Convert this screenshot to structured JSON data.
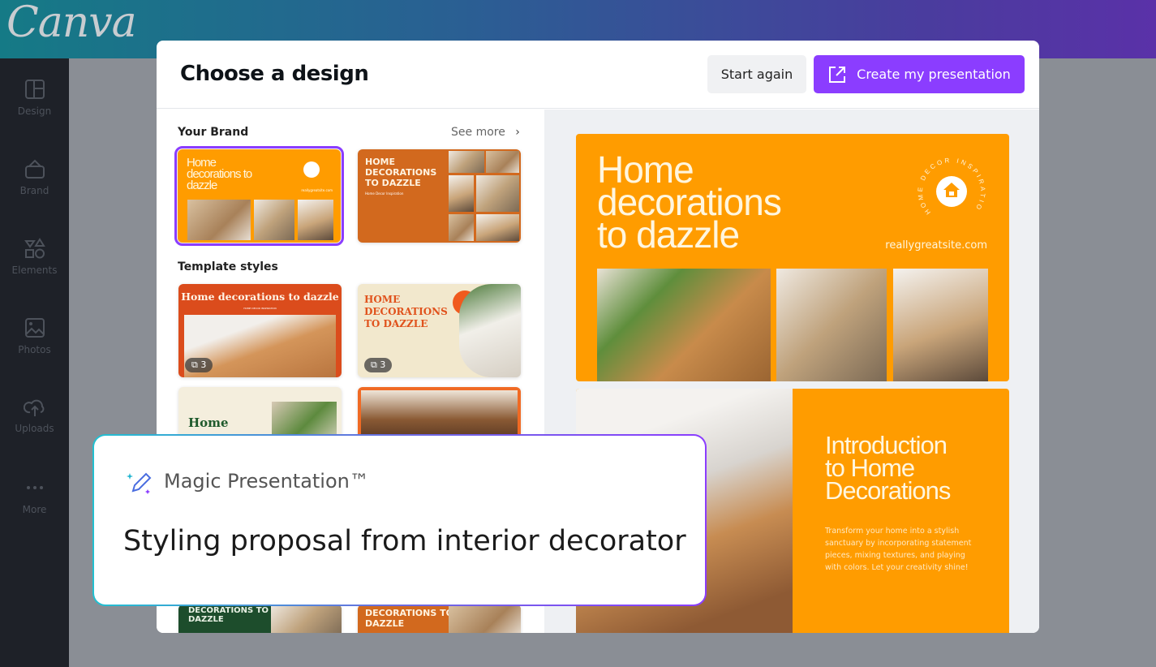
{
  "app": {
    "logo": "Canva"
  },
  "sidebar": {
    "items": [
      {
        "label": "Design",
        "icon": "layout-icon"
      },
      {
        "label": "Brand",
        "icon": "brand-kit-icon"
      },
      {
        "label": "Elements",
        "icon": "shapes-icon"
      },
      {
        "label": "Photos",
        "icon": "image-icon"
      },
      {
        "label": "Uploads",
        "icon": "cloud-upload-icon"
      },
      {
        "label": "More",
        "icon": "more-dots-icon"
      }
    ]
  },
  "modal": {
    "title": "Choose a design",
    "start_again": "Start again",
    "create": "Create my presentation",
    "accent": "#8b3dff",
    "your_brand": "Your Brand",
    "see_more": "See more",
    "template_styles": "Template styles",
    "brand_thumbs": [
      {
        "title": "Home decorations to dazzle",
        "site": "reallygreatsite.com",
        "selected": true
      },
      {
        "title": "HOME DECORATIONS TO DAZZLE",
        "subtitle": "Home Decor Inspiration"
      }
    ],
    "templates": [
      {
        "title": "Home decorations to dazzle",
        "subtitle": "HOME DECOR INSPIRATION",
        "pages": "3"
      },
      {
        "title": "HOME DECORATIONS TO DAZZLE",
        "pages": "3"
      },
      {
        "title": "Home"
      },
      {
        "title": ""
      }
    ],
    "bottom_thumbs": [
      {
        "title": "DECORATIONS TO DAZZLE"
      },
      {
        "title": "DECORATIONS TO DAZZLE"
      }
    ],
    "preview": {
      "slide1": {
        "title_lines": [
          "Home",
          "decorations",
          "to dazzle"
        ],
        "circle_text": "HOME DECOR INSPIRATION",
        "site": "reallygreatsite.com",
        "color": "#ff9c00"
      },
      "slide2": {
        "title_lines": [
          "Introduction",
          "to Home",
          "Decorations"
        ],
        "body": "Transform your home into a stylish sanctuary by incorporating statement pieces, mixing textures, and playing with colors. Let your creativity shine!"
      }
    }
  },
  "magic": {
    "label": "Magic Presentation™",
    "prompt": "Styling proposal from interior decorator"
  }
}
